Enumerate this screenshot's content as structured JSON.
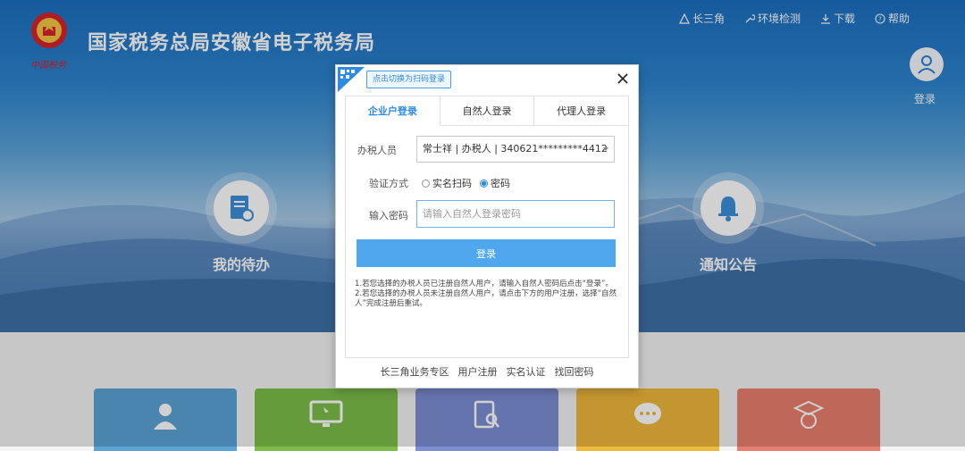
{
  "header": {
    "title": "国家税务总局安徽省电子税务局",
    "emblem_text": "中国税务"
  },
  "topnav": [
    {
      "icon": "triangle-icon",
      "label": "长三角"
    },
    {
      "icon": "wrench-icon",
      "label": "环境检测"
    },
    {
      "icon": "download-icon",
      "label": "下载"
    },
    {
      "icon": "help-icon",
      "label": "帮助"
    }
  ],
  "user": {
    "login_label": "登录"
  },
  "features": {
    "todo": "我的待办",
    "notice": "通知公告"
  },
  "modal": {
    "qr_tip": "点击切换为扫码登录",
    "tabs": [
      "企业户登录",
      "自然人登录",
      "代理人登录"
    ],
    "active_tab": 0,
    "taxpayer_label": "办税人员",
    "taxpayer_value": "常士祥 | 办税人 | 340621*********4412",
    "verify_label": "验证方式",
    "verify_options": [
      "实名扫码",
      "密码"
    ],
    "verify_selected": 1,
    "password_label": "输入密码",
    "password_placeholder": "请输入自然人登录密码",
    "login_button": "登录",
    "note1": "1.若您选择的办税人员已注册自然人用户，请输入自然人密码后点击“登录”。",
    "note2": "2.若您选择的办税人员未注册自然人用户，请点击下方的用户注册，选择“自然人”完成注册后重试。",
    "footer_links": [
      "长三角业务专区",
      "用户注册",
      "实名认证",
      "找回密码"
    ]
  },
  "colors": {
    "accent": "#2d8be6",
    "button": "#4fa8ee",
    "tile_colors": [
      "#5aa3d6",
      "#7dbd4a",
      "#7d8ed4",
      "#f0b83a",
      "#e97f6e"
    ]
  }
}
